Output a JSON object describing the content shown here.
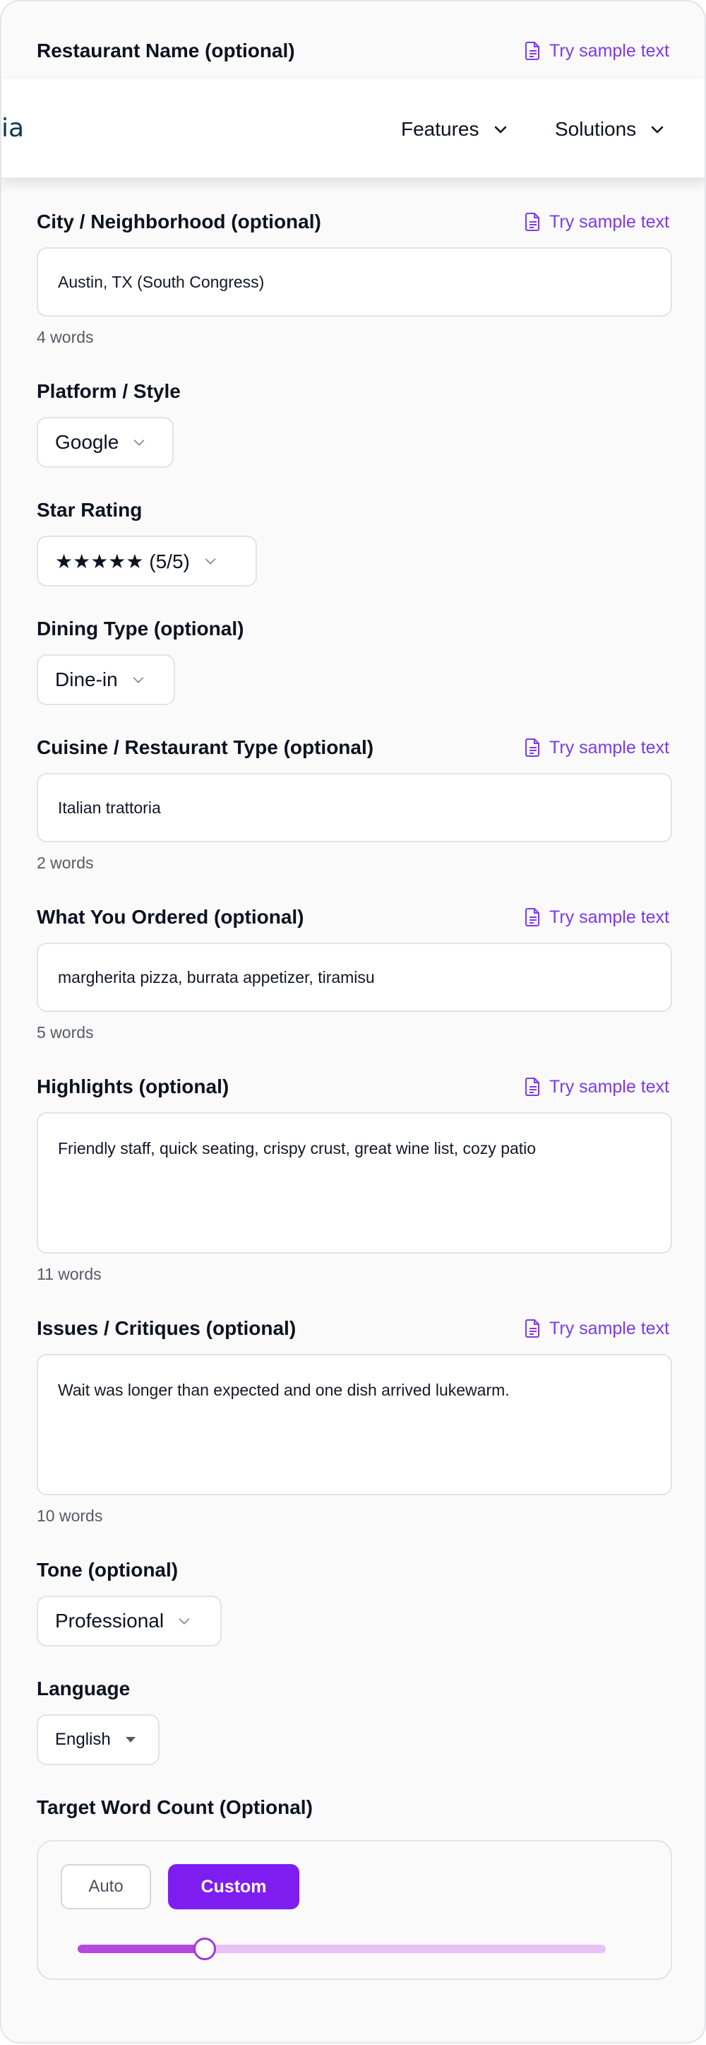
{
  "nav": {
    "logo_fragment": "ia",
    "features": "Features",
    "solutions": "Solutions"
  },
  "sample_link_label": "Try sample text",
  "fields": {
    "restaurant_name": {
      "label": "Restaurant Name (optional)"
    },
    "city": {
      "label": "City / Neighborhood (optional)",
      "value": "Austin, TX (South Congress)",
      "count": "4 words"
    },
    "platform": {
      "label": "Platform / Style",
      "value": "Google"
    },
    "star_rating": {
      "label": "Star Rating",
      "value": "★★★★★ (5/5)"
    },
    "dining_type": {
      "label": "Dining Type (optional)",
      "value": "Dine-in"
    },
    "cuisine": {
      "label": "Cuisine / Restaurant Type (optional)",
      "value": "Italian trattoria",
      "count": "2 words"
    },
    "ordered": {
      "label": "What You Ordered (optional)",
      "value": "margherita pizza, burrata appetizer, tiramisu",
      "count": "5 words"
    },
    "highlights": {
      "label": "Highlights (optional)",
      "value": "Friendly staff, quick seating, crispy crust, great wine list, cozy patio",
      "count": "11 words"
    },
    "issues": {
      "label": "Issues / Critiques (optional)",
      "value": "Wait was longer than expected and one dish arrived lukewarm.",
      "count": "10 words"
    },
    "tone": {
      "label": "Tone (optional)",
      "value": "Professional"
    },
    "language": {
      "label": "Language",
      "value": "English"
    },
    "word_count": {
      "label": "Target Word Count (Optional)",
      "auto_label": "Auto",
      "custom_label": "Custom",
      "selected_mode": "Custom",
      "slider_fraction": 0.24
    }
  },
  "colors": {
    "accent": "#7c3aed",
    "button_primary": "#7e1df0",
    "slider_fill": "#b648de",
    "slider_track": "#e8c2f3"
  },
  "icons": {
    "sample": "document-icon",
    "dropdown": "chevron-down-icon",
    "language_dropdown": "caret-down-icon"
  }
}
